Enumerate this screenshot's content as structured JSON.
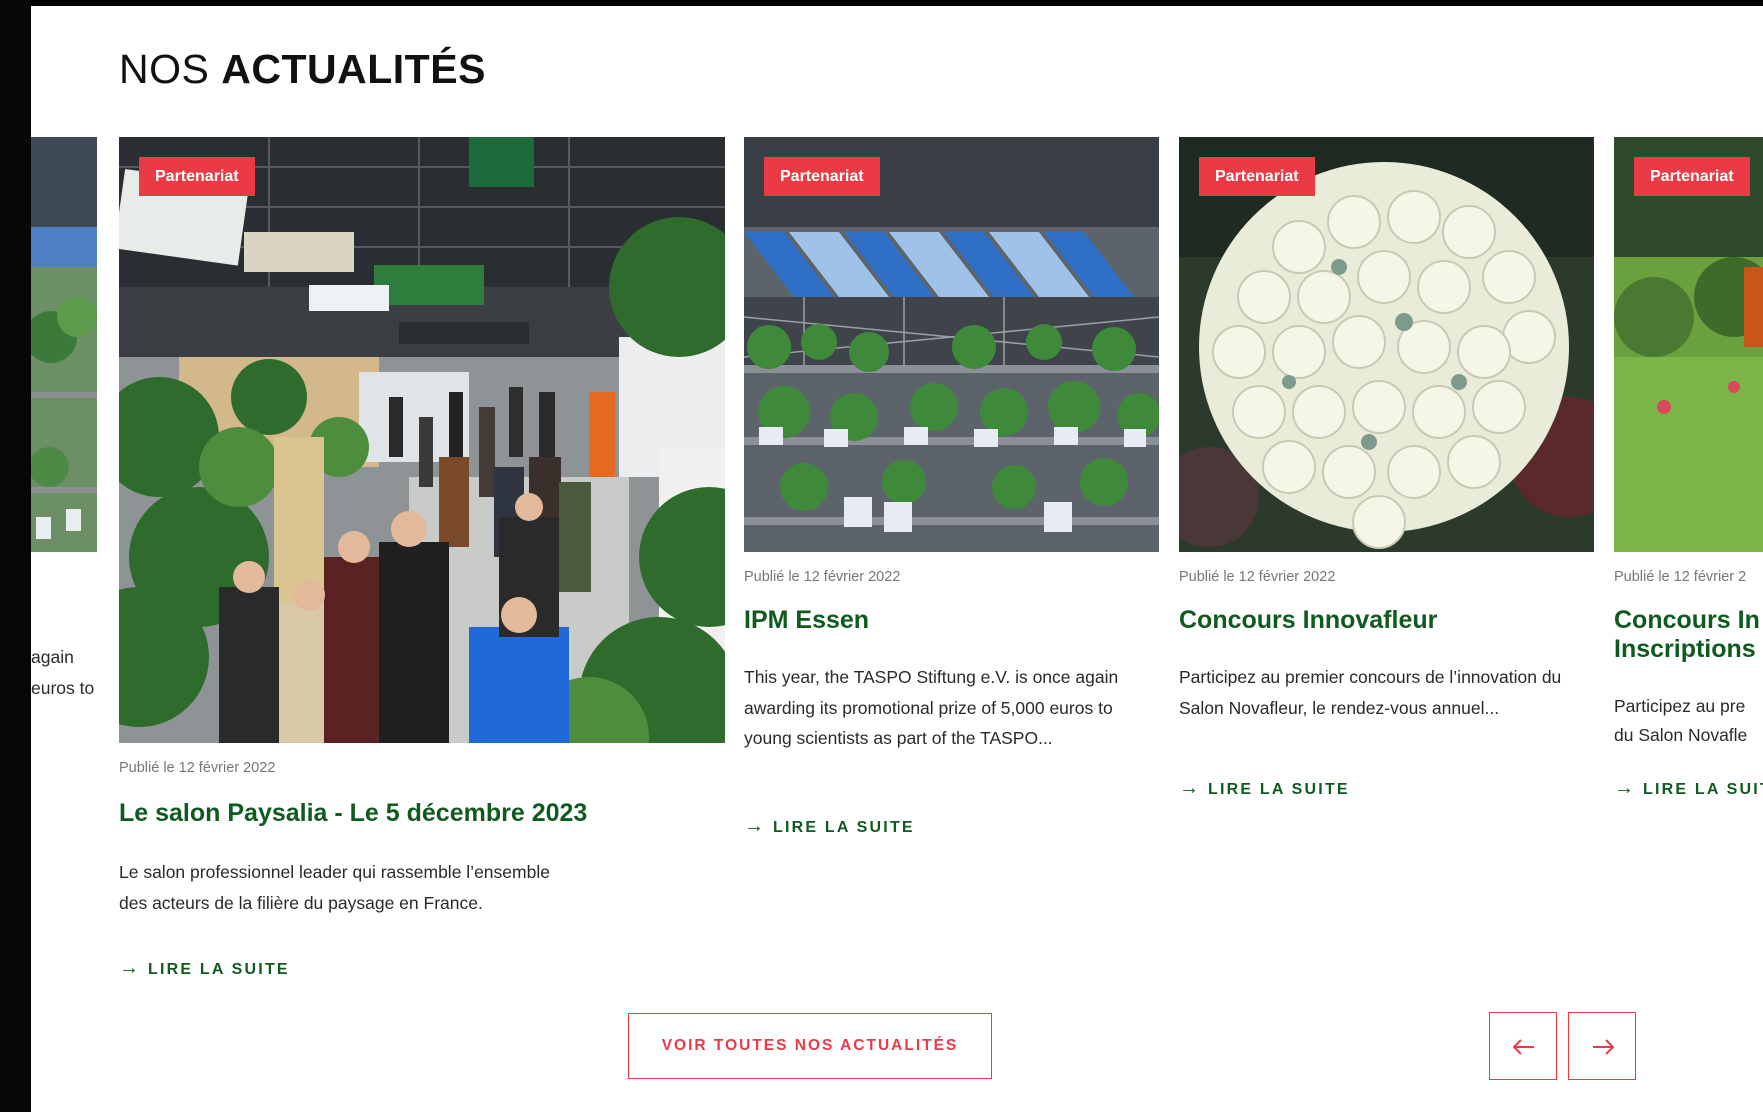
{
  "section": {
    "title_light": "NOS",
    "title_bold": "ACTUALITÉS"
  },
  "cards": [
    {
      "partial_excerpt": [
        " again",
        "euros to"
      ]
    },
    {
      "badge": "Partenariat",
      "date": "Publié le 12 février 2022",
      "title": "Le salon Paysalia - Le 5 décembre 2023",
      "excerpt": "Le salon professionnel leader qui rassemble l’ensemble des acteurs de la filière du paysage en France.",
      "read_more": "LIRE LA SUITE",
      "image": "indoor-trade-show-hall-with-plants-and-visitors"
    },
    {
      "badge": "Partenariat",
      "date": "Publié le 12 février 2022",
      "title": "IPM Essen",
      "excerpt": "This year, the TASPO Stiftung e.V. is once again awarding its promotional prize of 5,000 euros to young scientists as part of the TASPO...",
      "read_more": "LIRE LA SUITE",
      "image": "potted-plants-on-metal-display-shelves"
    },
    {
      "badge": "Partenariat",
      "date": "Publié le 12 février 2022",
      "title": "Concours Innovafleur",
      "excerpt": "Participez au premier concours de l’innovation du Salon Novafleur, le rendez-vous annuel...",
      "read_more": "LIRE LA SUITE",
      "image": "white-roses-bouquet"
    },
    {
      "badge": "Partenariat",
      "date": "Publié le 12 février 2",
      "title": "Concours In Inscriptions",
      "excerpt_lines": [
        "Participez au pre",
        "du Salon Novafle"
      ],
      "read_more": "LIRE LA SUIT",
      "image": "garden-hedge-with-machinery"
    }
  ],
  "buttons": {
    "all_news": "VOIR TOUTES NOS ACTUALITÉS",
    "prev_icon": "arrow-left-icon",
    "next_icon": "arrow-right-icon"
  },
  "colors": {
    "accent": "#e93a45",
    "title_green": "#0f5a1f",
    "text": "#2a2a2a",
    "date": "#777777"
  }
}
